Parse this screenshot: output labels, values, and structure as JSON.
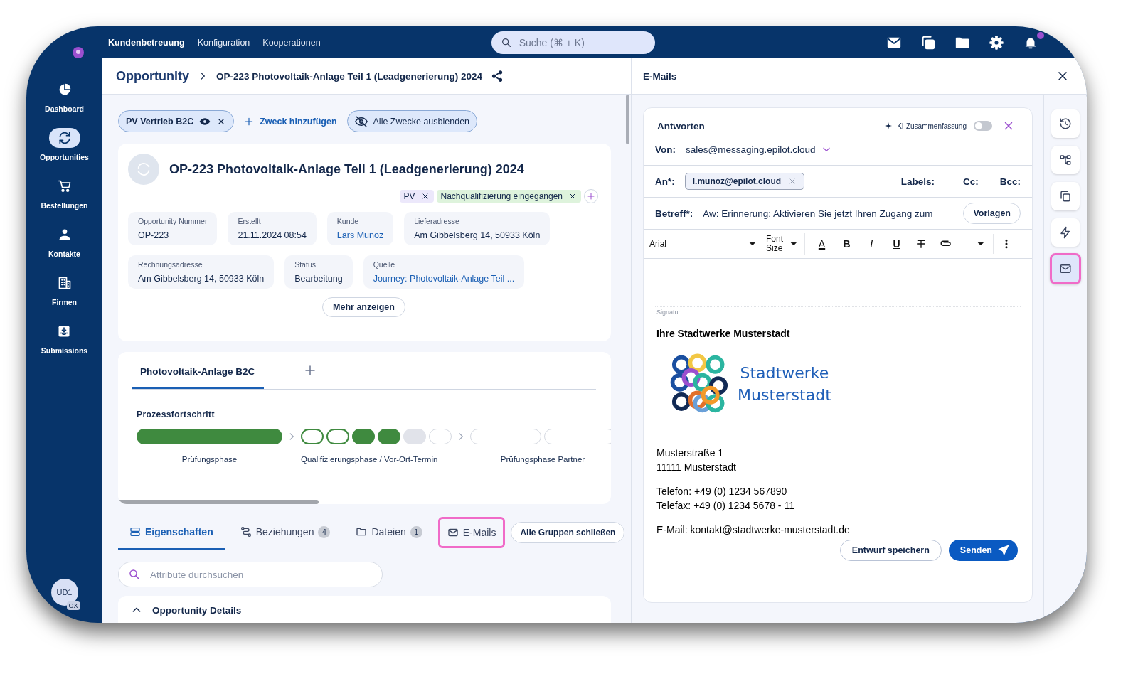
{
  "top_nav": {
    "items": [
      {
        "label": "Kundenbetreuung",
        "selected": true
      },
      {
        "label": "Konfiguration",
        "selected": false
      },
      {
        "label": "Kooperationen",
        "selected": false
      }
    ],
    "search": {
      "placeholder": "Suche (⌘ + K)"
    }
  },
  "sidebar": {
    "items": [
      {
        "label": "Dashboard",
        "kind": "dashboard",
        "selected": false
      },
      {
        "label": "Opportunities",
        "kind": "opportunities",
        "selected": true
      },
      {
        "label": "Bestellungen",
        "kind": "orders",
        "selected": false
      },
      {
        "label": "Kontakte",
        "kind": "contacts",
        "selected": false
      },
      {
        "label": "Firmen",
        "kind": "companies",
        "selected": false
      },
      {
        "label": "Submissions",
        "kind": "submissions",
        "selected": false
      }
    ],
    "user": {
      "initials": "UD1",
      "badge": "OX"
    }
  },
  "breadcrumb": {
    "root": "Opportunity",
    "current": "OP-223 Photovoltaik-Anlage Teil 1 (Leadgenerierung) 2024"
  },
  "purposes": {
    "chips": [
      {
        "label": "PV Vertrieb B2C"
      }
    ],
    "add": "Zweck hinzufügen",
    "hide_all": "Alle Zwecke ausblenden"
  },
  "record": {
    "title": "OP-223 Photovoltaik-Anlage Teil 1 (Leadgenerierung) 2024",
    "tags": [
      {
        "label": "PV",
        "color": "#ece8fb"
      },
      {
        "label": "Nachqualifizierung eingegangen",
        "color": "#def3dc"
      }
    ],
    "field_rows": [
      [
        {
          "label": "Opportunity Nummer",
          "value": "OP-223",
          "kind": "text"
        },
        {
          "label": "Erstellt",
          "value": "21.11.2024 08:54",
          "kind": "text"
        },
        {
          "label": "Kunde",
          "value": "Lars Munoz",
          "kind": "link"
        },
        {
          "label": "Lieferadresse",
          "value": "Am Gibbelsberg 14, 50933 Köln",
          "kind": "text"
        }
      ],
      [
        {
          "label": "Rechnungsadresse",
          "value": "Am Gibbelsberg 14, 50933 Köln",
          "kind": "text"
        },
        {
          "label": "Status",
          "value": "Bearbeitung",
          "kind": "text"
        },
        {
          "label": "Quelle",
          "value": "Journey: Photovoltaik-Anlage Teil ...",
          "kind": "link"
        }
      ]
    ],
    "more": "Mehr anzeigen"
  },
  "workflow": {
    "tabs": [
      {
        "label": "Photovoltaik-Anlage B2C",
        "selected": true
      }
    ],
    "progress_title": "Prozessfortschritt",
    "phases": [
      {
        "label": "Prüfungsphase",
        "steps": [
          {
            "kind": "done"
          }
        ]
      },
      {
        "label": "Qualifizierungsphase / Vor-Ort-Termin",
        "steps": [
          {
            "kind": "active"
          },
          {
            "kind": "active"
          },
          {
            "kind": "done"
          },
          {
            "kind": "done"
          },
          {
            "kind": "skipped"
          },
          {
            "kind": "pending"
          }
        ]
      },
      {
        "label": "Prüfungsphase Partner",
        "steps": [
          {
            "kind": "pending"
          },
          {
            "kind": "pending"
          }
        ]
      }
    ]
  },
  "detail_tabs": [
    {
      "label": "Eigenschaften",
      "kind": "properties",
      "selected": true,
      "highlighted": false
    },
    {
      "label": "Beziehungen",
      "kind": "relations",
      "count": "4",
      "selected": false,
      "highlighted": false
    },
    {
      "label": "Dateien",
      "kind": "files",
      "count": "1",
      "selected": false,
      "highlighted": false
    },
    {
      "label": "E-Mails",
      "kind": "emails",
      "selected": false,
      "highlighted": true
    }
  ],
  "collapse_all": "Alle Gruppen schließen",
  "attribute_search": {
    "placeholder": "Attribute durchsuchen"
  },
  "group": {
    "title": "Opportunity Details",
    "expanded": true
  },
  "email_panel": {
    "title": "E-Mails",
    "compose": {
      "mode": "Antworten",
      "ai_summary": {
        "label": "KI-Zusammenfassung",
        "on": false
      },
      "from_label": "Von:",
      "from": "sales@messaging.epilot.cloud",
      "to_label": "An*:",
      "recipients": [
        "l.munoz@epilot.cloud"
      ],
      "labels": "Labels:",
      "cc": "Cc:",
      "bcc": "Bcc:",
      "subject_label": "Betreff*:",
      "subject": "Aw: Erinnerung: Aktivieren Sie jetzt Ihren Zugang zum",
      "templates": "Vorlagen",
      "toolbar": {
        "font": "Arial",
        "font_size": "Font Size",
        "buttons": [
          {
            "kind": "color",
            "label": "A"
          },
          {
            "kind": "bold",
            "label": "B"
          },
          {
            "kind": "italic",
            "label": "I"
          },
          {
            "kind": "underline",
            "label": "U"
          },
          {
            "kind": "strike"
          },
          {
            "kind": "link"
          }
        ]
      },
      "signature_label": "Signatur",
      "signature": {
        "heading": "Ihre Stadtwerke Musterstadt",
        "logo_text": [
          "Stadtwerke",
          "Musterstadt"
        ],
        "blocks": [
          [
            "Musterstraße 1",
            "11111 Musterstadt"
          ],
          [
            "Telefon: +49 (0) 1234 567890",
            "Telefax: +49 (0) 1234 5678 - 11"
          ],
          [
            "E-Mail: kontakt@stadtwerke-musterstadt.de"
          ]
        ]
      },
      "save_draft": "Entwurf speichern",
      "send": "Senden"
    }
  },
  "right_rail": [
    {
      "kind": "history",
      "selected": false,
      "highlighted": false
    },
    {
      "kind": "hierarchy",
      "selected": false,
      "highlighted": false
    },
    {
      "kind": "copy",
      "selected": false,
      "highlighted": false
    },
    {
      "kind": "automation",
      "selected": false,
      "highlighted": false
    },
    {
      "kind": "email",
      "selected": true,
      "highlighted": true
    }
  ]
}
